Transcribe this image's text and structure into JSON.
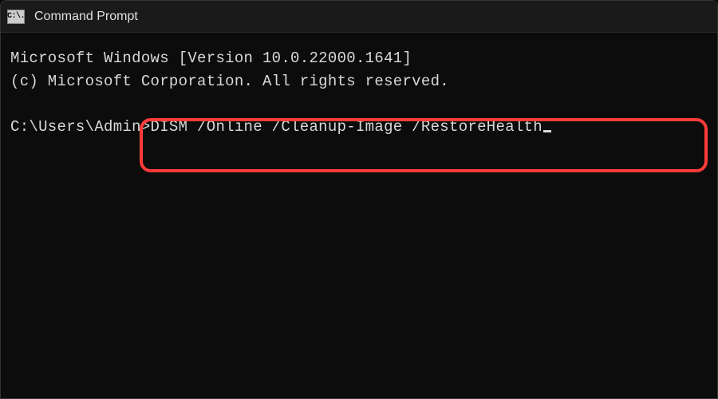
{
  "titlebar": {
    "icon_label": "C:\\.",
    "title": "Command Prompt"
  },
  "terminal": {
    "version_line": "Microsoft Windows [Version 10.0.22000.1641]",
    "copyright_line": "(c) Microsoft Corporation. All rights reserved.",
    "prompt": "C:\\Users\\Admin>",
    "command": "DISM /Online /Cleanup-Image /RestoreHealth"
  }
}
